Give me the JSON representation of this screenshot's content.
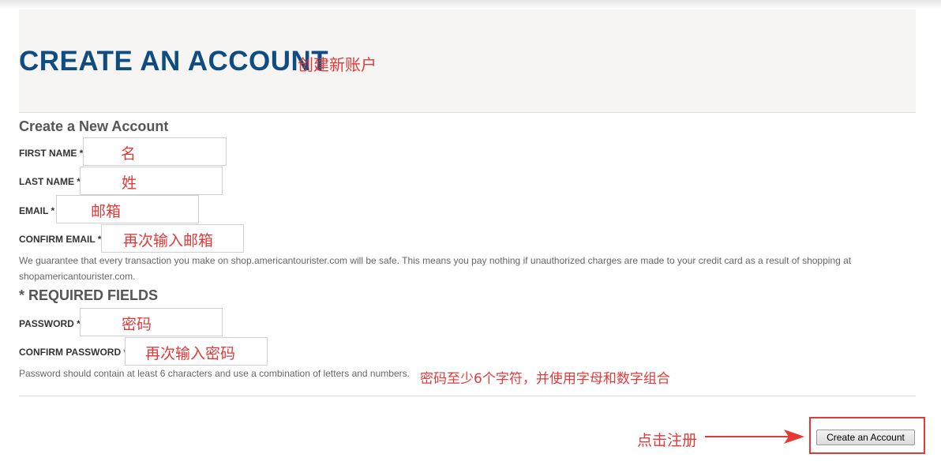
{
  "header": {
    "title": "CREATE AN ACCOUNT",
    "title_annotation": "创建新账户"
  },
  "form": {
    "section_title": "Create a New Account",
    "fields": {
      "first_name": {
        "label": "FIRST NAME *",
        "hint": "名"
      },
      "last_name": {
        "label": "LAST NAME *",
        "hint": "姓"
      },
      "email": {
        "label": "EMAIL *",
        "hint": "邮箱"
      },
      "confirm_email": {
        "label": "CONFIRM EMAIL *",
        "hint": "再次输入邮箱"
      },
      "password": {
        "label": "PASSWORD *",
        "hint": "密码"
      },
      "confirm_password": {
        "label": "CONFIRM PASSWORD *",
        "hint": "再次输入密码"
      }
    },
    "guarantee_text": "We guarantee that every transaction you make on shop.americantourister.com will be safe. This means you pay nothing if unauthorized charges are made to your credit card as a result of shopping at shopamericantourister.com.",
    "required_text": "* REQUIRED FIELDS",
    "password_help": "Password should contain at least 6 characters and use a combination of letters and numbers.",
    "password_help_annotation": "密码至少6个字符，并使用字母和数字组合"
  },
  "submit": {
    "label": "Create an Account",
    "annotation": "点击注册"
  },
  "colors": {
    "title": "#0f4c81",
    "annotation": "#e03a3a",
    "highlight_frame": "#e53935"
  }
}
